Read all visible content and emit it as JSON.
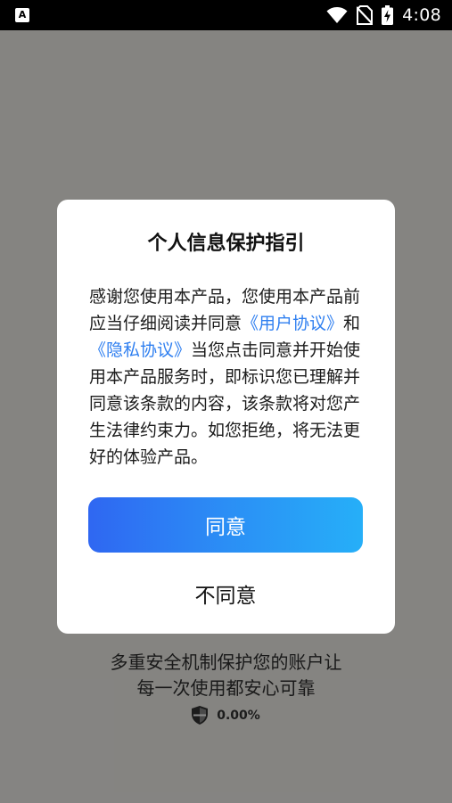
{
  "status_bar": {
    "app_badge": "A",
    "time": "4:08",
    "icons": [
      "wifi-icon",
      "no-sim-icon",
      "battery-charging-icon"
    ]
  },
  "background": {
    "slogan_line1": "多重安全机制保护您的账户让",
    "slogan_line2": "每一次使用都安心可靠",
    "progress_text": "0.00%",
    "progress_icon": "shield-icon"
  },
  "dialog": {
    "title": "个人信息保护指引",
    "body_intro": "感谢您使用本产品，您使用本产品前应当仔细阅读并同意",
    "user_agreement_link": "《用户协议》",
    "conjunction": "和",
    "privacy_policy_link": "《隐私协议》",
    "body_rest": "当您点击同意并开始使用本产品服务时，即标识您已理解并同意该条款的内容，该条款将对您产生法律约束力。如您拒绝，将无法更好的体验产品。",
    "agree_label": "同意",
    "disagree_label": "不同意"
  },
  "colors": {
    "link": "#2f7ff0",
    "agree_gradient_start": "#2f67f2",
    "agree_gradient_end": "#26aff8"
  }
}
